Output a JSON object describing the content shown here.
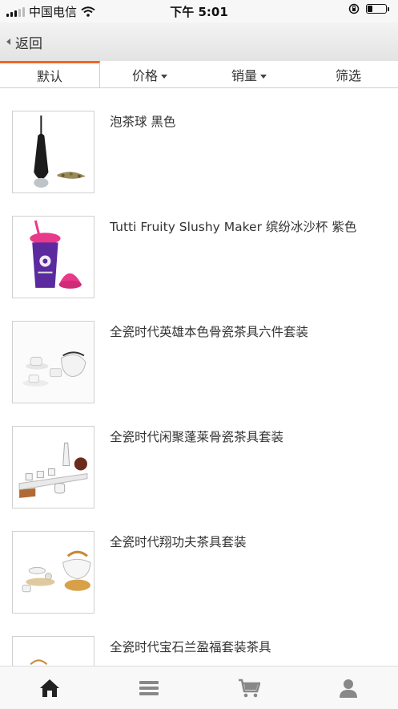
{
  "status_bar": {
    "carrier": "中国电信",
    "time": "下午 5:01",
    "battery_level": 0.25,
    "icons": [
      "signal-icon",
      "wifi-icon",
      "rotation-lock-icon",
      "battery-icon"
    ]
  },
  "nav": {
    "back_label": "返回"
  },
  "sort_tabs": [
    {
      "label": "默认",
      "active": true,
      "has_caret": false
    },
    {
      "label": "价格",
      "active": false,
      "has_caret": true
    },
    {
      "label": "销量",
      "active": false,
      "has_caret": true
    },
    {
      "label": "筛选",
      "active": false,
      "has_caret": false
    }
  ],
  "products": [
    {
      "title": "泡茶球 黑色",
      "image": "tea-infuser-image"
    },
    {
      "title": "Tutti Fruity Slushy Maker 缤纷冰沙杯 紫色",
      "image": "slushy-cup-image"
    },
    {
      "title": "全瓷时代英雄本色骨瓷茶具六件套装",
      "image": "white-tea-set-image"
    },
    {
      "title": "全瓷时代闲聚蓬莱骨瓷茶具套装",
      "image": "tea-tray-set-image"
    },
    {
      "title": "全瓷时代翔功夫茶具套装",
      "image": "kungfu-tea-set-image"
    },
    {
      "title": "全瓷时代宝石兰盈福套装茶具",
      "image": "blue-tea-set-image"
    }
  ],
  "tab_bar": [
    {
      "name": "home",
      "icon": "home-icon",
      "active": true
    },
    {
      "name": "menu",
      "icon": "menu-icon",
      "active": false
    },
    {
      "name": "cart",
      "icon": "cart-icon",
      "active": false
    },
    {
      "name": "account",
      "icon": "user-icon",
      "active": false
    }
  ],
  "colors": {
    "accent": "#f26522",
    "active_icon": "#222222",
    "inactive_icon": "#888888"
  }
}
